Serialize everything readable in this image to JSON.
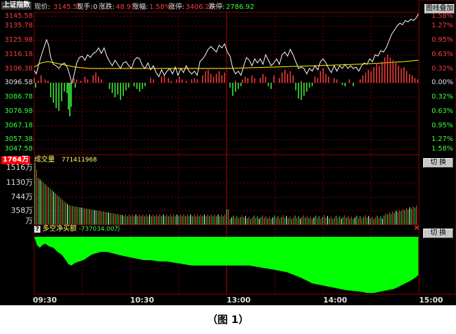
{
  "header": {
    "index_name": "上证指数",
    "price_label": "现价:",
    "price_value": "3145.55",
    "volume_label": "现手:",
    "volume_value": "0",
    "change_label": "涨跌:",
    "change_value": "48.97",
    "amplitude_label": "涨幅:",
    "amplitude_value": "1.58%",
    "limit_up_label": "涨停:",
    "limit_up_value": "3406.24",
    "limit_down_label": "跌停:",
    "limit_down_value": "2786.92",
    "overlay_button": "图线叠加"
  },
  "price_axis": {
    "left": [
      "3145.58",
      "3135.78",
      "3125.98",
      "3116.18",
      "3106.38",
      "3096.58",
      "3086.78",
      "3076.98",
      "3067.18",
      "3057.38",
      "3047.58"
    ],
    "right": [
      "1.58%",
      "1.27%",
      "0.95%",
      "0.63%",
      "0.32%",
      "0.00%",
      "0.32%",
      "0.63%",
      "0.95%",
      "1.27%",
      "1.58%"
    ]
  },
  "volume_panel": {
    "max_badge": "1764万",
    "title": "成交量",
    "total": "771411968",
    "ticks": [
      "1516万",
      "1130万",
      "744万",
      "358万",
      "万"
    ],
    "switch_button": "切 换"
  },
  "net_buy_panel": {
    "question_icon": "?",
    "title": "多空净买额",
    "value": "-737034.00万",
    "close_icon": "×",
    "switch_button": "切 换"
  },
  "time_axis": [
    "09:30",
    "10:30",
    "13:00",
    "14:00",
    "15:00"
  ],
  "caption": "（图 1）",
  "colors": {
    "up": "#ff3c3c",
    "down": "#3cff3c",
    "grid": "#8b0000",
    "price_line": "#ffffff",
    "avg_line": "#ffff00",
    "fill": "#00ff00"
  }
}
